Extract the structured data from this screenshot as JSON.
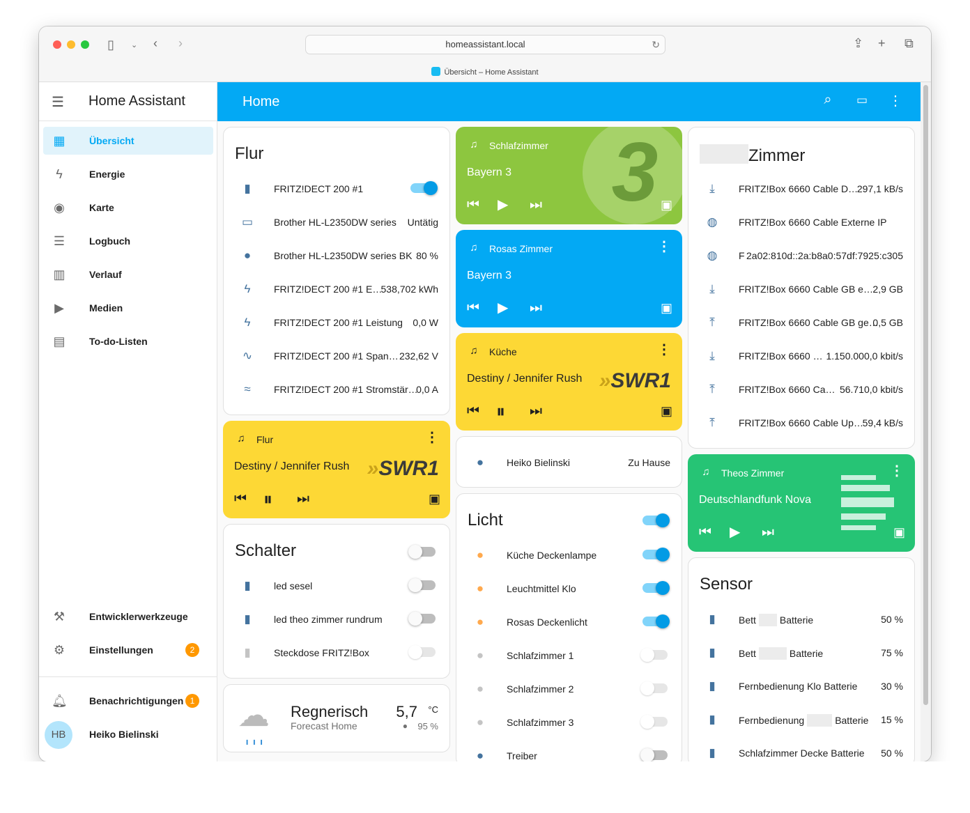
{
  "browser": {
    "url": "homeassistant.local",
    "tab_title": "Übersicht – Home Assistant"
  },
  "sidebar": {
    "title": "Home Assistant",
    "items": [
      {
        "label": "Übersicht",
        "icon": "dashboard-icon",
        "glyph": "▦"
      },
      {
        "label": "Energie",
        "icon": "lightning-icon",
        "glyph": "ϟ"
      },
      {
        "label": "Karte",
        "icon": "map-person-icon",
        "glyph": "◉"
      },
      {
        "label": "Logbuch",
        "icon": "list-icon",
        "glyph": "☰"
      },
      {
        "label": "Verlauf",
        "icon": "chart-icon",
        "glyph": "▥"
      },
      {
        "label": "Medien",
        "icon": "media-icon",
        "glyph": "▶"
      },
      {
        "label": "To-do-Listen",
        "icon": "clipboard-icon",
        "glyph": "▤"
      }
    ],
    "bottom": [
      {
        "label": "Entwicklerwerkzeuge",
        "icon": "hammer-icon",
        "glyph": "⚒"
      },
      {
        "label": "Einstellungen",
        "icon": "gear-icon",
        "glyph": "⚙",
        "badge": "2"
      }
    ],
    "notifications": {
      "label": "Benachrichtigungen",
      "badge": "1"
    },
    "user": {
      "initials": "HB",
      "name": "Heiko Bielinski"
    }
  },
  "header": {
    "title": "Home"
  },
  "flur": {
    "title": "Flur",
    "rows": [
      {
        "name": "FRITZ!DECT 200 #1",
        "value": "",
        "icon": "socket-icon",
        "glyph": "▮"
      },
      {
        "name": "Brother HL-L2350DW series",
        "value": "Untätig",
        "icon": "printer-icon",
        "glyph": "▭"
      },
      {
        "name": "Brother HL-L2350DW series BK",
        "value": "80 %",
        "icon": "water-icon",
        "glyph": "●"
      },
      {
        "name": "FRITZ!DECT 200 #1 E…",
        "value": "538,702 kWh",
        "icon": "lightning-icon",
        "glyph": "ϟ"
      },
      {
        "name": "FRITZ!DECT 200 #1 Leistung",
        "value": "0,0 W",
        "icon": "flash-icon",
        "glyph": "ϟ"
      },
      {
        "name": "FRITZ!DECT 200 #1 Span…",
        "value": "232,62 V",
        "icon": "sine-wave-icon",
        "glyph": "∿"
      },
      {
        "name": "FRITZ!DECT 200 #1 Stromstär…",
        "value": "0,0 A",
        "icon": "current-ac-icon",
        "glyph": "≈"
      }
    ]
  },
  "media_flur": {
    "name": "Flur",
    "title": "Destiny / Jennifer Rush",
    "logo": "SWR1"
  },
  "schalter": {
    "title": "Schalter",
    "rows": [
      {
        "name": "led sesel"
      },
      {
        "name": "led theo zimmer rundrum"
      },
      {
        "name": "Steckdose FRITZ!Box"
      }
    ]
  },
  "weather": {
    "state": "Regnerisch",
    "name": "Forecast Home",
    "temp": "5,7",
    "unit": "°C",
    "humidity": "95 %"
  },
  "media_schlaf": {
    "name": "Schlafzimmer",
    "title": "Bayern 3",
    "logo": "3"
  },
  "media_rosa": {
    "name": "Rosas Zimmer",
    "title": "Bayern 3"
  },
  "media_kueche": {
    "name": "Küche",
    "title": "Destiny / Jennifer Rush",
    "logo": "SWR1"
  },
  "person": {
    "name": "Heiko Bielinski",
    "state": "Zu Hause"
  },
  "licht": {
    "title": "Licht",
    "rows": [
      {
        "name": "Küche Deckenlampe",
        "on": true
      },
      {
        "name": "Leuchtmittel Klo",
        "on": true
      },
      {
        "name": "Rosas Deckenlicht",
        "on": true
      },
      {
        "name": "Schlafzimmer 1",
        "on": false
      },
      {
        "name": "Schlafzimmer 2",
        "on": false
      },
      {
        "name": "Schlafzimmer 3",
        "on": false
      },
      {
        "name": "Treiber",
        "on": false
      }
    ]
  },
  "zimmer": {
    "title": "Zimmer",
    "rows": [
      {
        "name": "FRITZ!Box 6660 Cable D…",
        "value": "297,1 kB/s",
        "icon": "download-icon",
        "glyph": "⤓"
      },
      {
        "name": "FRITZ!Box 6660 Cable Externe IP",
        "value": "",
        "icon": "globe-icon",
        "glyph": "◍"
      },
      {
        "name": "F",
        "value": "2a02:810d::2a:b8a0:57df:7925:c305",
        "icon": "globe-icon",
        "glyph": "◍"
      },
      {
        "name": "FRITZ!Box 6660 Cable GB e…",
        "value": "2,9 GB",
        "icon": "download-icon",
        "glyph": "⤓"
      },
      {
        "name": "FRITZ!Box 6660 Cable GB ge…",
        "value": "0,5 GB",
        "icon": "upload-icon",
        "glyph": "⤒"
      },
      {
        "name": "FRITZ!Box 6660 …",
        "value": "1.150.000,0 kbit/s",
        "icon": "download-icon",
        "glyph": "⤓"
      },
      {
        "name": "FRITZ!Box 6660 Ca…",
        "value": "56.710,0 kbit/s",
        "icon": "upload-icon",
        "glyph": "⤒"
      },
      {
        "name": "FRITZ!Box 6660 Cable Up…",
        "value": "59,4 kB/s",
        "icon": "upload-icon",
        "glyph": "⤒"
      }
    ]
  },
  "media_theo": {
    "name": "Theos Zimmer",
    "title": "Deutschlandfunk Nova"
  },
  "sensor": {
    "title": "Sensor",
    "rows": [
      {
        "name": "Bett",
        "name2": "Batterie",
        "value": "50 %"
      },
      {
        "name": "Bett",
        "name2": "Batterie",
        "value": "75 %"
      },
      {
        "name": "Fernbedienung Klo Batterie",
        "name2": "",
        "value": "30 %"
      },
      {
        "name": "Fernbedienung",
        "name2": "Batterie",
        "value": "15 %"
      },
      {
        "name": "Schlafzimmer Decke Batterie",
        "name2": "",
        "value": "50 %"
      }
    ]
  },
  "colors": {
    "accent": "#03a9f4",
    "yellow": "#fdd835",
    "green": "#8bc34a",
    "teal": "#26c475",
    "bulb_on": "#ffa94d"
  }
}
